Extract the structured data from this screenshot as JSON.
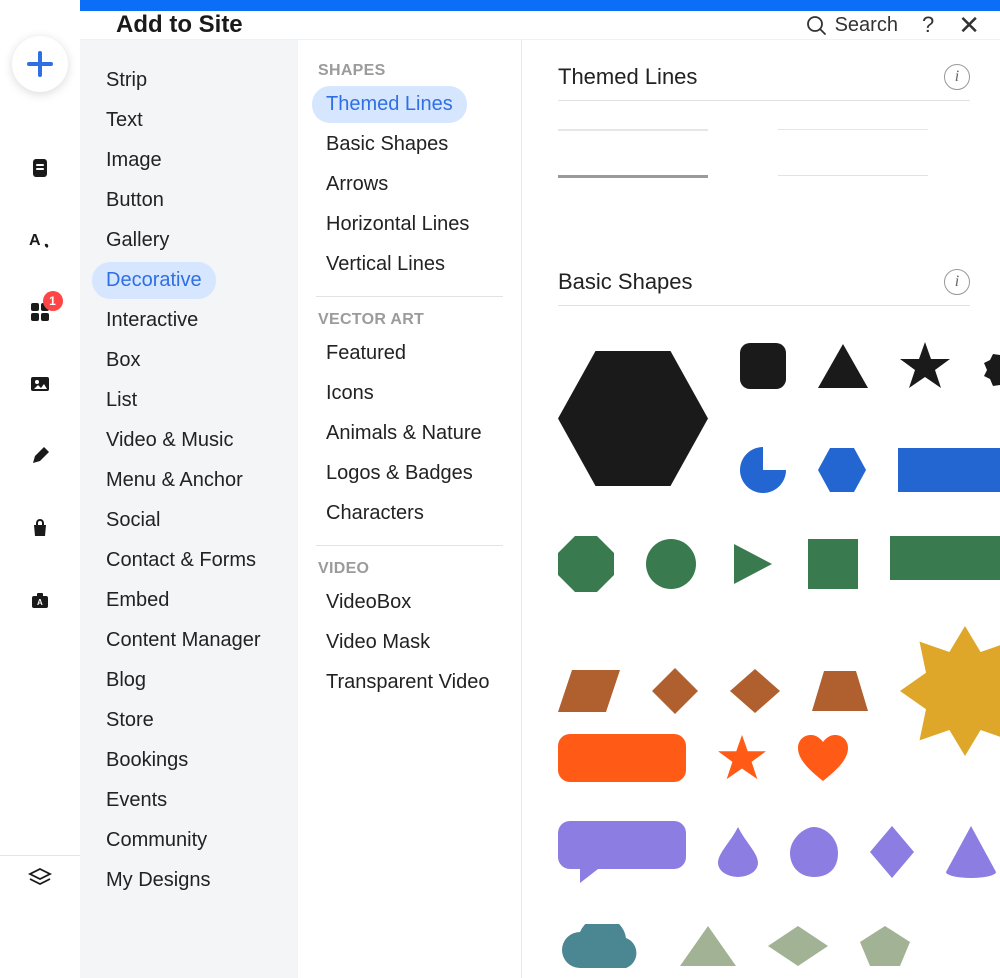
{
  "header": {
    "title": "Add to Site",
    "search": "Search",
    "help": "?",
    "close": "✕"
  },
  "rail": {
    "badge": "1"
  },
  "categories": [
    {
      "label": "Strip"
    },
    {
      "label": "Text"
    },
    {
      "label": "Image"
    },
    {
      "label": "Button"
    },
    {
      "label": "Gallery"
    },
    {
      "label": "Decorative",
      "selected": true
    },
    {
      "label": "Interactive"
    },
    {
      "label": "Box"
    },
    {
      "label": "List"
    },
    {
      "label": "Video & Music"
    },
    {
      "label": "Menu & Anchor"
    },
    {
      "label": "Social"
    },
    {
      "label": "Contact & Forms"
    },
    {
      "label": "Embed"
    },
    {
      "label": "Content Manager"
    },
    {
      "label": "Blog"
    },
    {
      "label": "Store"
    },
    {
      "label": "Bookings"
    },
    {
      "label": "Events"
    },
    {
      "label": "Community"
    },
    {
      "label": "My Designs"
    }
  ],
  "subgroups": [
    {
      "head": "SHAPES",
      "items": [
        {
          "label": "Themed Lines",
          "selected": true
        },
        {
          "label": "Basic Shapes"
        },
        {
          "label": "Arrows"
        },
        {
          "label": "Horizontal Lines"
        },
        {
          "label": "Vertical Lines"
        }
      ]
    },
    {
      "head": "VECTOR ART",
      "items": [
        {
          "label": "Featured"
        },
        {
          "label": "Icons"
        },
        {
          "label": "Animals & Nature"
        },
        {
          "label": "Logos & Badges"
        },
        {
          "label": "Characters"
        }
      ]
    },
    {
      "head": "VIDEO",
      "items": [
        {
          "label": "VideoBox"
        },
        {
          "label": "Video Mask"
        },
        {
          "label": "Transparent Video"
        }
      ]
    }
  ],
  "sections": {
    "themed": "Themed Lines",
    "basic": "Basic Shapes"
  },
  "colors": {
    "black": "#1a1a1a",
    "blue": "#2366d1",
    "green": "#3a7a4f",
    "brown": "#b0602f",
    "orange": "#ff5a16",
    "gold": "#dfa72a",
    "purple": "#8c7de3",
    "teal": "#4a8792",
    "olive": "#a2b294"
  }
}
